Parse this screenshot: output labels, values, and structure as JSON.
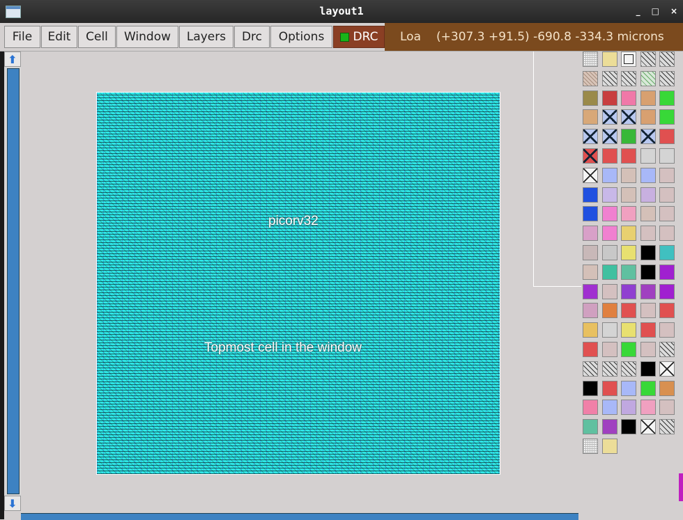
{
  "window": {
    "title": "layout1",
    "controls": [
      "_",
      "□",
      "×"
    ]
  },
  "menubar": {
    "items": [
      "File",
      "Edit",
      "Cell",
      "Window",
      "Layers",
      "Drc",
      "Options"
    ]
  },
  "drc_button": {
    "label": "DRC",
    "led_color": "#18b418"
  },
  "status": {
    "mode": "Loa",
    "coords": "(+307.3 +91.5) -690.8 -334.3 microns"
  },
  "scroll": {
    "up_icon": "⬆",
    "down_icon": "⬇"
  },
  "layout": {
    "cell_name": "picorv32",
    "cell_note": "Topmost cell in the window",
    "fill_color": "#2fe6e6"
  },
  "palette": {
    "columns": 5,
    "rows": [
      [
        "hatch-white",
        "#ecdd98",
        "box-white",
        "diag-grey",
        "diag-grey"
      ],
      [
        "hatch-tan",
        "diag-grey",
        "diag-grey",
        "diag-green",
        "diag-grey"
      ],
      [
        "#9a8a4a",
        "#c83e3e",
        "#f078a8",
        "#d8a070",
        "#38d838"
      ],
      [
        "#d8a878",
        "x-blue",
        "x-blue",
        "#d8a070",
        "#38d838"
      ],
      [
        "x-blue",
        "x-blue",
        "#38b838",
        "x-blue",
        "#e05050"
      ],
      [
        "x-red",
        "#e05050",
        "#e05050",
        "#d4d4d4",
        "#d4d4d4"
      ],
      [
        "box-x",
        "#a8b8f8",
        "#d4c0b8",
        "#a8b8f8",
        "#d4c0c0"
      ],
      [
        "#2050e0",
        "#c8b8e8",
        "#d4c0b8",
        "#c8b0e0",
        "#d4c0c0"
      ],
      [
        "#2050e0",
        "#f080d0",
        "#f0a0c0",
        "#d4c0b8",
        "#d4c0c0"
      ],
      [
        "#d8a0c8",
        "#f080d0",
        "#e8d070",
        "#d4c0c0",
        "#d4c0c0"
      ],
      [
        "#c8b8b8",
        "#c8c8c8",
        "#e8e070",
        "#000000",
        "#40c0c0"
      ],
      [
        "#d4c0b8",
        "#40c0a0",
        "#60c0a0",
        "#000000",
        "#a020d0"
      ],
      [
        "#a030d0",
        "#d4c0c0",
        "#9040d0",
        "#a040c0",
        "#a020d0"
      ],
      [
        "#d0a0c0",
        "#e08040",
        "#e05050",
        "#d4c0c0",
        "#e05050"
      ],
      [
        "#e8c060",
        "#d4d4d4",
        "#e8e070",
        "#e05050",
        "#d4c0c0"
      ],
      [
        "#e05050",
        "#d4c0c0",
        "#38d838",
        "#d4c0c0",
        "diag-grey"
      ],
      [
        "diag-grey",
        "diag-grey",
        "diag-grey",
        "#000000",
        "box-x"
      ],
      [
        "#000000",
        "#e05050",
        "#a8b8f8",
        "#38d838",
        "#d89050"
      ],
      [
        "#f080a8",
        "#a8b8f8",
        "#c0a8e0",
        "#f0a0c0",
        "#d4c0c0"
      ],
      [
        "#60c0a0",
        "#a040c0",
        "#000000",
        "box-x",
        "diag-grey"
      ],
      [
        "hatch-white",
        "#ecdd98"
      ]
    ]
  }
}
